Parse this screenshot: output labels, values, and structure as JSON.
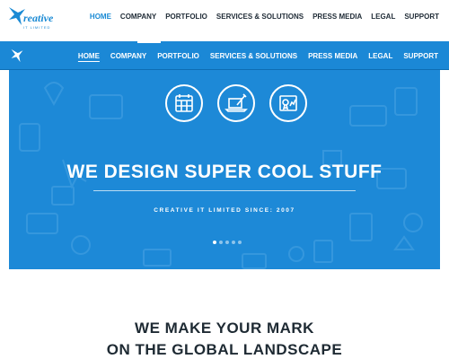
{
  "logo": {
    "brand": "reative",
    "tagline": "IT LIMITED"
  },
  "nav": {
    "items": [
      {
        "label": "HOME",
        "active": true
      },
      {
        "label": "COMPANY",
        "active": false
      },
      {
        "label": "PORTFOLIO",
        "active": false
      },
      {
        "label": "SERVICES & SOLUTIONS",
        "active": false
      },
      {
        "label": "PRESS MEDIA",
        "active": false
      },
      {
        "label": "LEGAL",
        "active": false
      },
      {
        "label": "SUPPORT",
        "active": false
      }
    ]
  },
  "hero": {
    "title": "WE DESIGN SUPER COOL STUFF",
    "subtitle": "CREATIVE IT LIMITED SINCE: 2007",
    "icons": [
      "calendar-grid-icon",
      "laptop-pen-icon",
      "certificate-chart-icon"
    ],
    "slides": 5,
    "active_slide": 1
  },
  "section": {
    "heading_line1": "WE MAKE YOUR MARK",
    "heading_line2": "ON THE GLOBAL LANDSCAPE"
  },
  "colors": {
    "brand_blue": "#1b88d6",
    "dark_text": "#1f2b36",
    "white": "#ffffff"
  }
}
